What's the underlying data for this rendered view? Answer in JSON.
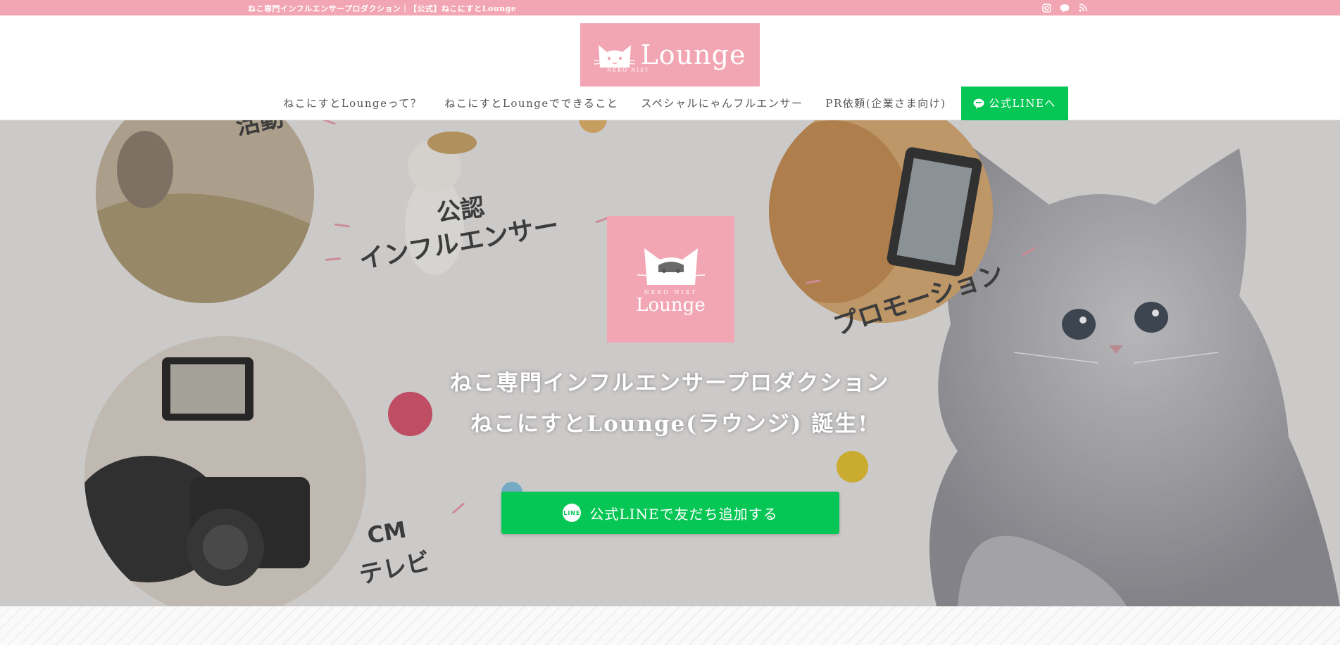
{
  "topbar": {
    "tagline": "ねこ専門インフルエンサープロダクション｜【公式】ねこにすとLounge",
    "icons": [
      "instagram-icon",
      "line-icon",
      "rss-icon"
    ],
    "bg_color": "#f2a6b3"
  },
  "logo": {
    "word": "Lounge",
    "sub": "NEKO NIST"
  },
  "nav": {
    "items": [
      {
        "label": "ねこにすとLoungeって？"
      },
      {
        "label": "ねこにすとLoungeでできること"
      },
      {
        "label": "スペシャルにゃんフルエンサー"
      },
      {
        "label": "PR依頼(企業さま向け)"
      }
    ],
    "line_button": "公式LINEへ",
    "line_color": "#06c755"
  },
  "hero": {
    "center_logo_sub": "NEKO NIST",
    "center_logo_word": "Lounge",
    "headline_1": "ねこ専門インフルエンサープロダクション",
    "headline_2": "ねこにすとLounge(ラウンジ) 誕生!",
    "cta_label": "公式LINEで友だち追加する",
    "cta_icon_text": "LINE",
    "labels": {
      "top_left": "活動",
      "influencer_1": "公認",
      "influencer_2": "インフルエンサー",
      "promotion": "プロモーション",
      "cm": "CM",
      "tv": "テレビ"
    }
  }
}
